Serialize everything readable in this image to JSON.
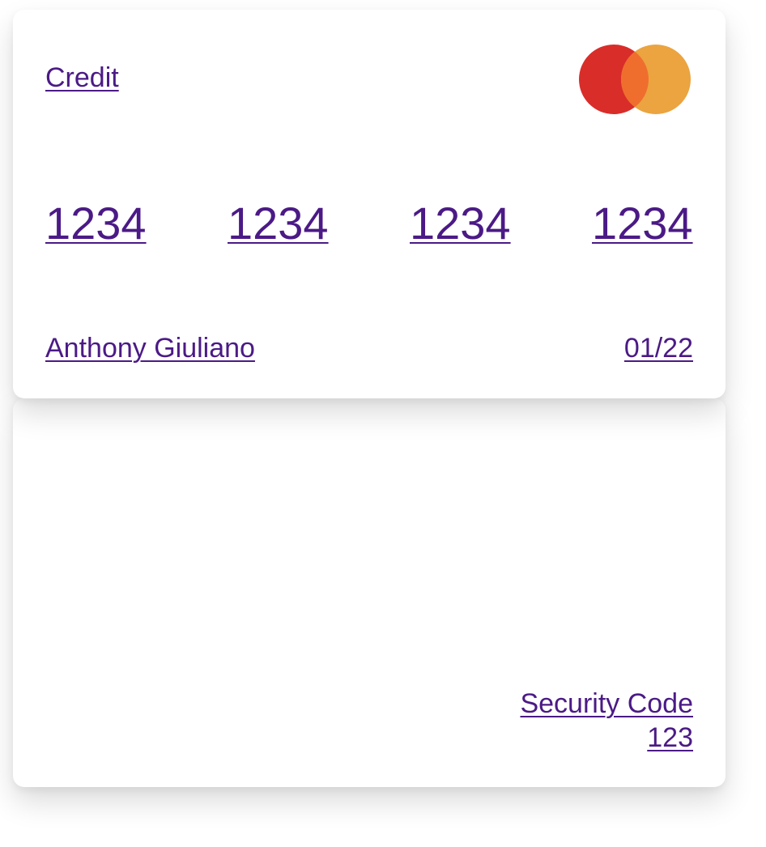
{
  "card_front": {
    "type_label": "Credit",
    "brand_logo_icon": "mastercard-logo-icon",
    "number_groups": [
      "1234",
      "1234",
      "1234",
      "1234"
    ],
    "holder_name": "Anthony Giuliano",
    "expiry": "01/22"
  },
  "card_back": {
    "security_code_label": "Security Code",
    "security_code_value": "123"
  },
  "colors": {
    "link": "#4b1a86",
    "logo_red": "#d92d2a",
    "logo_orange": "#eba43f",
    "logo_overlap": "#ef6e2e",
    "card_background": "#ffffff"
  }
}
